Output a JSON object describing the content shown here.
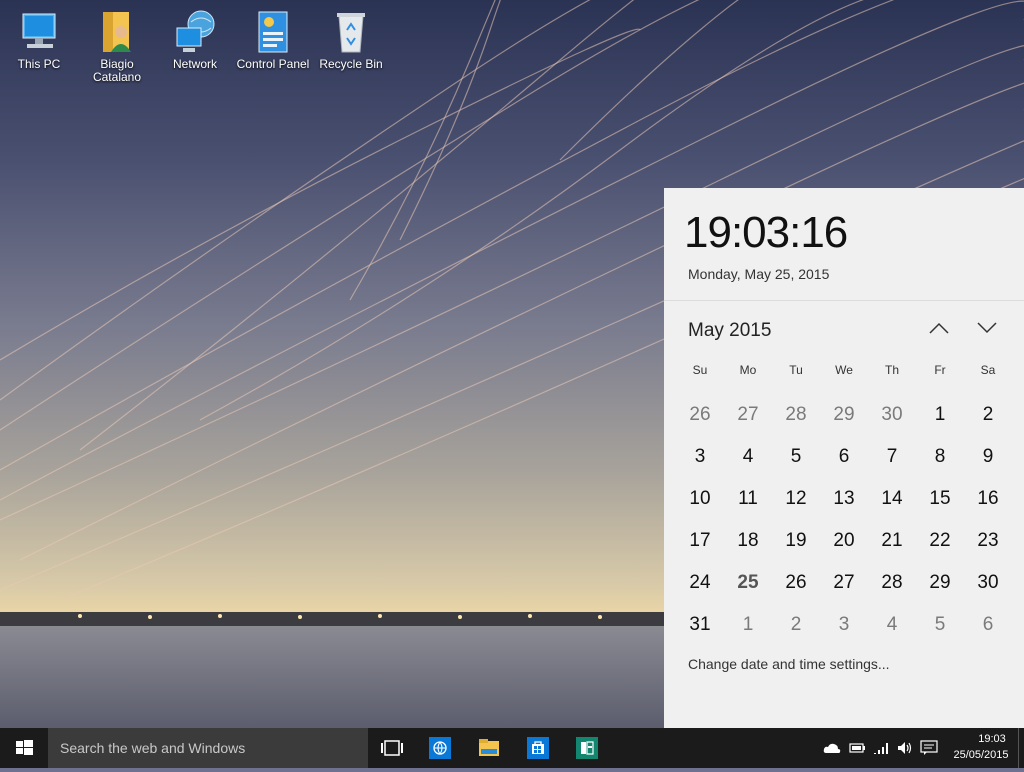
{
  "desktop": {
    "icons": [
      {
        "label": "This PC",
        "icon": "this-pc-icon"
      },
      {
        "label": "Biagio Catalano",
        "label_line1": "Biagio",
        "label_line2": "Catalano",
        "icon": "user-folder-icon"
      },
      {
        "label": "Network",
        "icon": "network-icon"
      },
      {
        "label": "Control Panel",
        "icon": "control-panel-icon"
      },
      {
        "label": "Recycle Bin",
        "icon": "recycle-bin-icon"
      }
    ]
  },
  "clock_flyout": {
    "time": "19:03:16",
    "date": "Monday, May 25, 2015",
    "month_label": "May 2015",
    "weekdays": [
      "Su",
      "Mo",
      "Tu",
      "We",
      "Th",
      "Fr",
      "Sa"
    ],
    "weeks": [
      [
        {
          "d": "26",
          "other": true
        },
        {
          "d": "27",
          "other": true
        },
        {
          "d": "28",
          "other": true
        },
        {
          "d": "29",
          "other": true
        },
        {
          "d": "30",
          "other": true
        },
        {
          "d": "1"
        },
        {
          "d": "2"
        }
      ],
      [
        {
          "d": "3"
        },
        {
          "d": "4"
        },
        {
          "d": "5"
        },
        {
          "d": "6"
        },
        {
          "d": "7"
        },
        {
          "d": "8"
        },
        {
          "d": "9"
        }
      ],
      [
        {
          "d": "10"
        },
        {
          "d": "11"
        },
        {
          "d": "12"
        },
        {
          "d": "13"
        },
        {
          "d": "14"
        },
        {
          "d": "15"
        },
        {
          "d": "16"
        }
      ],
      [
        {
          "d": "17"
        },
        {
          "d": "18"
        },
        {
          "d": "19"
        },
        {
          "d": "20"
        },
        {
          "d": "21"
        },
        {
          "d": "22"
        },
        {
          "d": "23"
        }
      ],
      [
        {
          "d": "24"
        },
        {
          "d": "25",
          "today": true
        },
        {
          "d": "26"
        },
        {
          "d": "27"
        },
        {
          "d": "28"
        },
        {
          "d": "29"
        },
        {
          "d": "30"
        }
      ],
      [
        {
          "d": "31"
        },
        {
          "d": "1",
          "other": true
        },
        {
          "d": "2",
          "other": true
        },
        {
          "d": "3",
          "other": true
        },
        {
          "d": "4",
          "other": true
        },
        {
          "d": "5",
          "other": true
        },
        {
          "d": "6",
          "other": true
        }
      ]
    ],
    "settings_link": "Change date and time settings..."
  },
  "taskbar": {
    "search_placeholder": "Search the web and Windows",
    "tray_time": "19:03",
    "tray_date": "25/05/2015",
    "pinned": [
      "task-view-icon",
      "browser-icon",
      "file-explorer-icon",
      "store-icon",
      "app-icon"
    ]
  },
  "colors": {
    "taskbar": "#1b1b1b",
    "search_box": "#3b3b3b",
    "flyout_bg": "#f0f0f0",
    "accent": "#0a78d7"
  }
}
